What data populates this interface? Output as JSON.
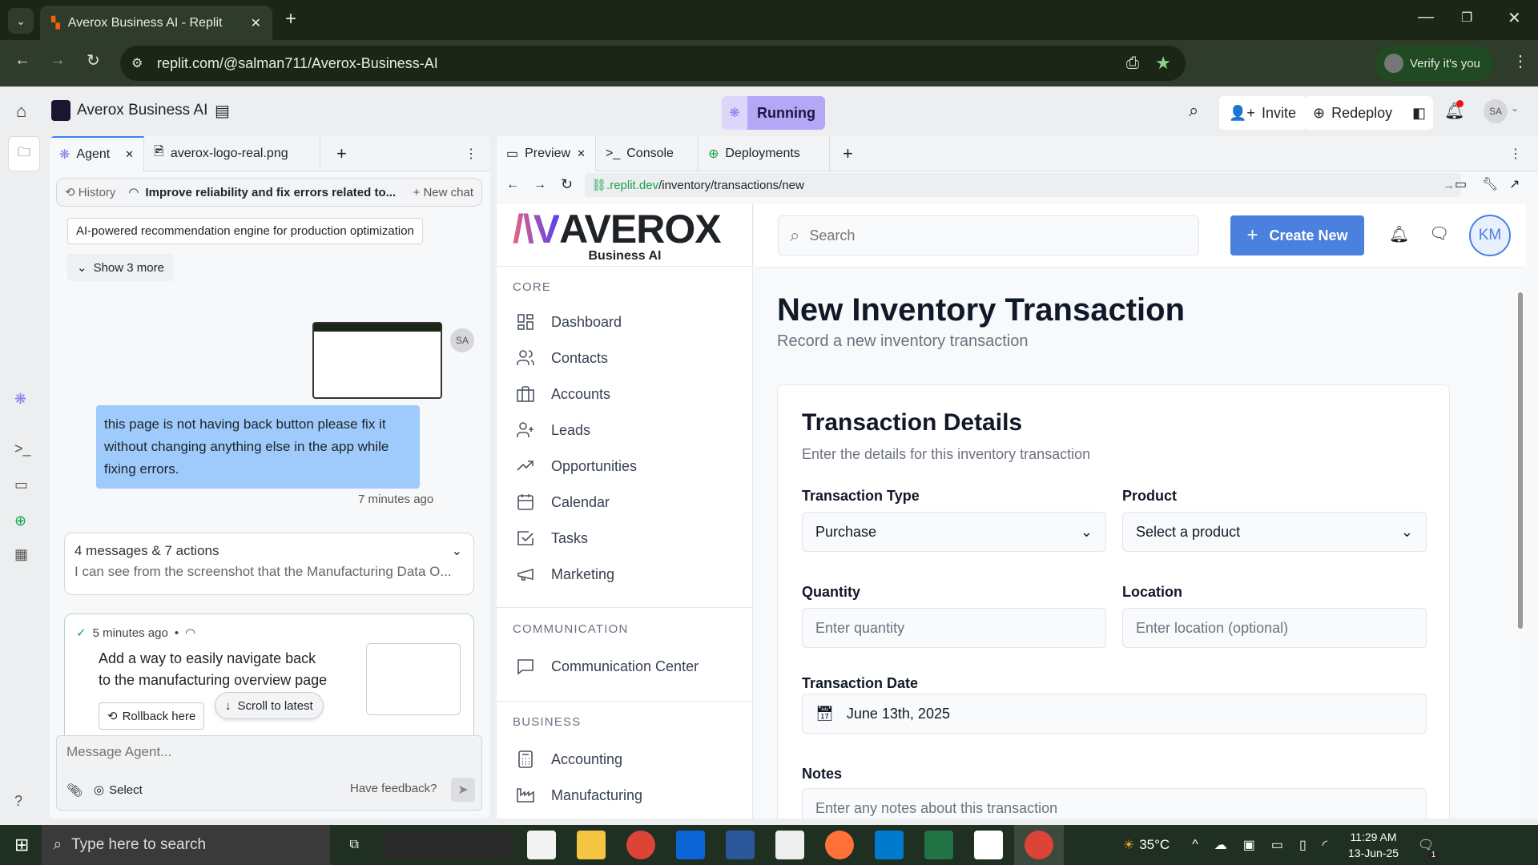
{
  "browser": {
    "tab_title": "Averox Business AI - Replit",
    "url": "replit.com/@salman711/Averox-Business-AI",
    "verify": "Verify it's you"
  },
  "replit": {
    "project": "Averox Business AI",
    "status": "Running",
    "invite": "Invite",
    "redeploy": "Redeploy",
    "avatar": "SA"
  },
  "agent_panel": {
    "tabs": [
      "Agent",
      "averox-logo-real.png"
    ],
    "history": "History",
    "thread_title": "Improve reliability and fix errors related to...",
    "new_chat": "New chat",
    "suggestion": "AI-powered recommendation engine for production optimization",
    "show_more": "Show 3 more",
    "user_avatar": "SA",
    "user_message": "this page is not having back button please fix it without changing anything else in the app while fixing errors.",
    "user_time": "7 minutes ago",
    "summary_title": "4 messages & 7 actions",
    "summary_text": "I can see from the screenshot that the Manufacturing Data O...",
    "checkpoint_time": "5 minutes ago",
    "checkpoint_text": "Add a way to easily navigate back to the manufacturing overview page",
    "rollback": "Rollback here",
    "scroll_latest": "Scroll to latest",
    "input_placeholder": "Message Agent...",
    "select": "Select",
    "feedback": "Have feedback?"
  },
  "preview_panel": {
    "tabs": [
      "Preview",
      "Console",
      "Deployments"
    ],
    "url_host": ".replit.dev",
    "url_path": "/inventory/transactions/new"
  },
  "app": {
    "logo": "AVEROX",
    "logo_sub": "Business AI",
    "search_placeholder": "Search",
    "create_new": "Create New",
    "user_initials": "KM",
    "sections": [
      {
        "title": "CORE",
        "items": [
          "Dashboard",
          "Contacts",
          "Accounts",
          "Leads",
          "Opportunities",
          "Calendar",
          "Tasks",
          "Marketing"
        ]
      },
      {
        "title": "COMMUNICATION",
        "items": [
          "Communication Center"
        ]
      },
      {
        "title": "BUSINESS",
        "items": [
          "Accounting",
          "Manufacturing"
        ]
      }
    ],
    "page_title": "New Inventory Transaction",
    "page_subtitle": "Record a new inventory transaction",
    "card_title": "Transaction Details",
    "card_subtitle": "Enter the details for this inventory transaction",
    "fields": {
      "type_label": "Transaction Type",
      "type_value": "Purchase",
      "product_label": "Product",
      "product_value": "Select a product",
      "quantity_label": "Quantity",
      "quantity_placeholder": "Enter quantity",
      "location_label": "Location",
      "location_placeholder": "Enter location (optional)",
      "date_label": "Transaction Date",
      "date_value": "June 13th, 2025",
      "notes_label": "Notes",
      "notes_placeholder": "Enter any notes about this transaction"
    }
  },
  "taskbar": {
    "search": "Type here to search",
    "weather": "35°C",
    "time": "11:29 AM",
    "date": "13-Jun-25",
    "notif_count": "1"
  },
  "colors": {
    "accent": "#3b82f6",
    "create_btn": "#4a80de",
    "running": "#b4a7f5",
    "user_bubble": "#9ecbfb"
  }
}
